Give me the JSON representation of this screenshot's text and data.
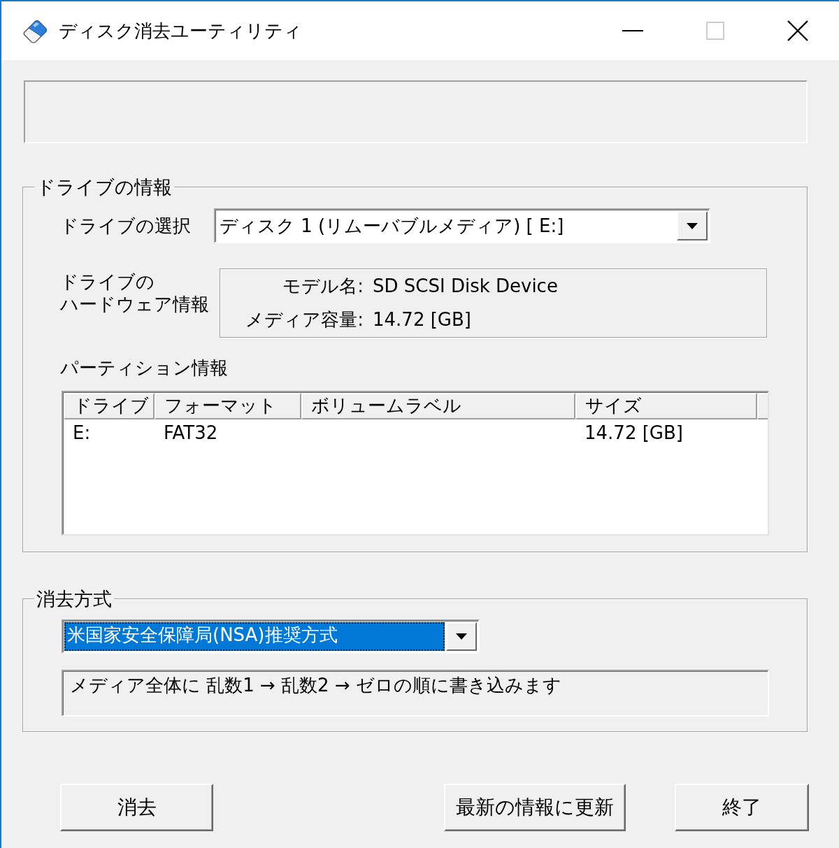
{
  "window": {
    "title": "ディスク消去ユーティリティ",
    "maximize_disabled": true
  },
  "drive_info": {
    "legend": "ドライブの情報",
    "drive_select": {
      "label": "ドライブの選択",
      "value": "ディスク 1 (リムーバブルメディア) [ E:]"
    },
    "hardware": {
      "label_lines": [
        "ドライブの",
        "ハードウェア情報"
      ],
      "fields": [
        {
          "label": "モデル名:",
          "value": "SD SCSI Disk Device"
        },
        {
          "label": "メディア容量:",
          "value": "14.72 [GB]"
        }
      ]
    },
    "partition": {
      "label": "パーティション情報",
      "columns": [
        "ドライブ",
        "フォーマット",
        "ボリュームラベル",
        "サイズ"
      ],
      "rows": [
        {
          "cells": [
            "E:",
            "FAT32",
            null,
            "14.72 [GB]"
          ]
        }
      ]
    }
  },
  "erase_method": {
    "legend": "消去方式",
    "method_select": {
      "value": "米国家安全保障局(NSA)推奨方式",
      "focused": true
    },
    "description": "メディア全体に 乱数1 → 乱数2 → ゼロの順に書き込みます"
  },
  "buttons": [
    {
      "label": "消去"
    },
    {
      "label": "最新の情報に更新"
    },
    {
      "label": "終了"
    }
  ]
}
